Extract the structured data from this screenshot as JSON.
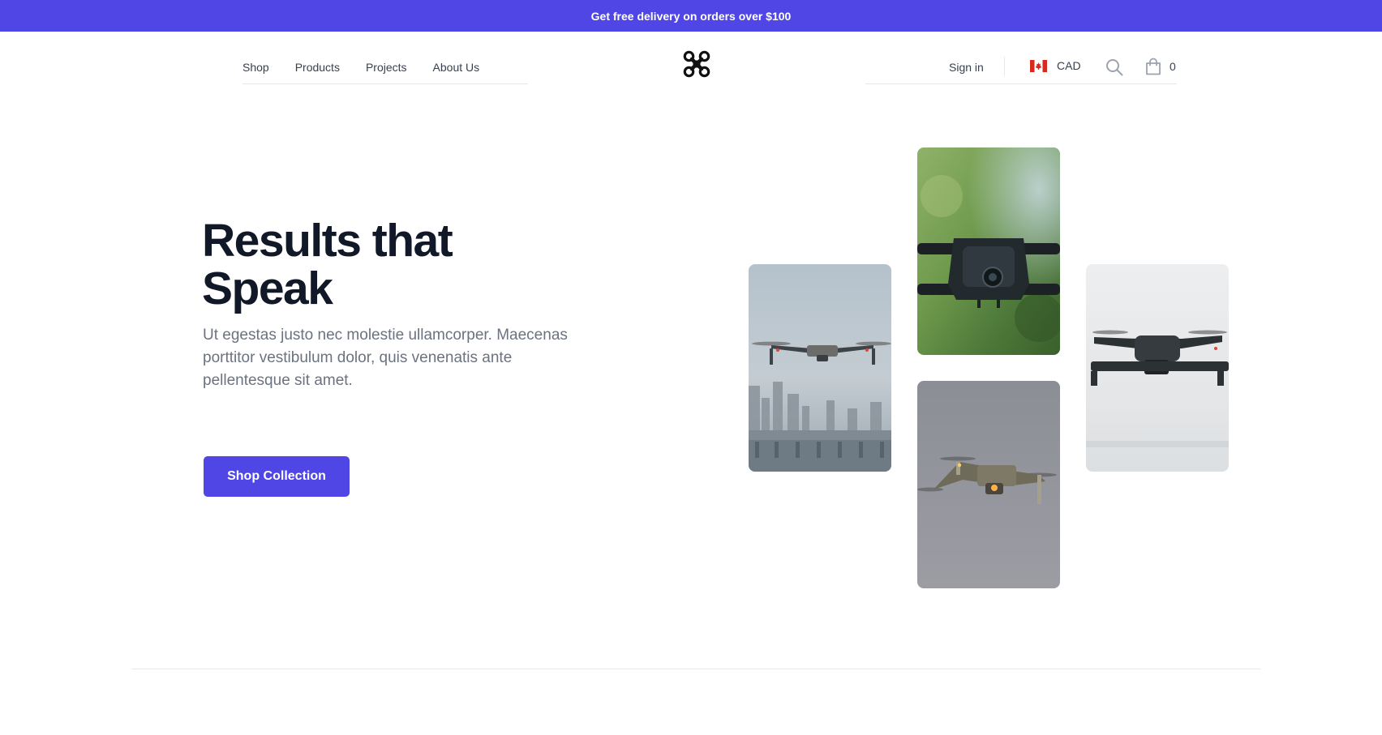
{
  "promo": {
    "text": "Get free delivery on orders over $100"
  },
  "nav": {
    "left": [
      {
        "label": "Shop"
      },
      {
        "label": "Products"
      },
      {
        "label": "Projects"
      },
      {
        "label": "About Us"
      }
    ],
    "logo_icon": "drone-logo-icon",
    "sign_in": "Sign in",
    "currency": {
      "code": "CAD",
      "flag_icon": "canada-flag-icon"
    },
    "search_icon": "search-icon",
    "cart": {
      "icon": "shopping-bag-icon",
      "count": "0"
    }
  },
  "hero": {
    "title_line1": "Results that",
    "title_line2": "Speak",
    "description": "Ut egestas justo nec molestie ullamcorper. Maecenas porttitor vestibulum dolor, quis venenatis ante pellentesque sit amet.",
    "cta": "Shop Collection"
  },
  "gallery": [
    {
      "name": "drone-over-city-image"
    },
    {
      "name": "drone-closeup-green-image"
    },
    {
      "name": "drone-grey-sky-image"
    },
    {
      "name": "drone-white-sky-image"
    }
  ],
  "colors": {
    "accent": "#4f46e5",
    "heading": "#111827",
    "body_text": "#6b7280",
    "nav_text": "#374151",
    "border": "#e5e7eb"
  }
}
